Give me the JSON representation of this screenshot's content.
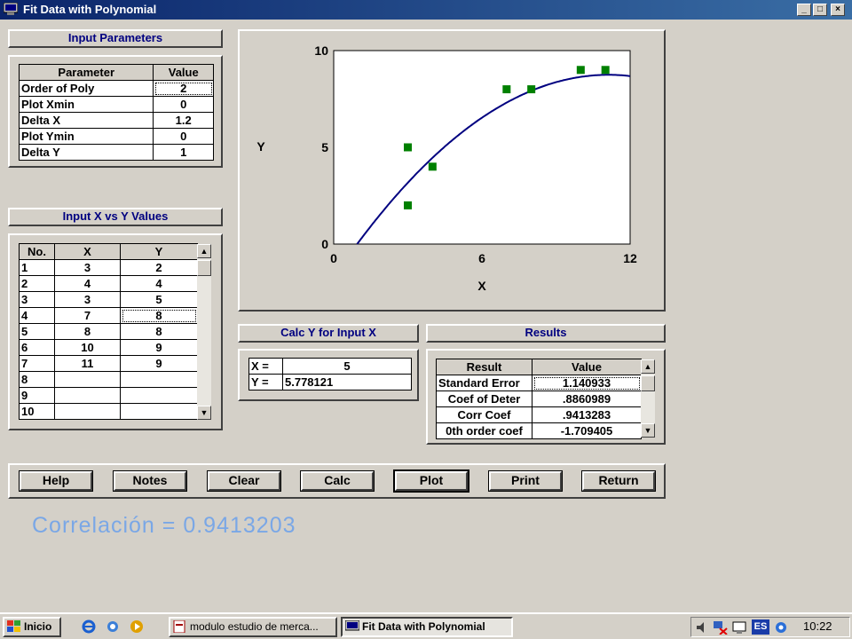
{
  "window": {
    "title": "Fit Data with Polynomial",
    "controls": [
      "_",
      "□",
      "×"
    ]
  },
  "input_parameters": {
    "header": "Input Parameters",
    "columns": [
      "Parameter",
      "Value"
    ],
    "rows": [
      [
        "Order of Poly",
        "2"
      ],
      [
        "Plot Xmin",
        "0"
      ],
      [
        "Delta X",
        "1.2"
      ],
      [
        "Plot Ymin",
        "0"
      ],
      [
        "Delta Y",
        "1"
      ]
    ]
  },
  "xy_values": {
    "header": "Input X vs Y Values",
    "columns": [
      "No.",
      "X",
      "Y"
    ],
    "rows": [
      [
        "1",
        "3",
        "2"
      ],
      [
        "2",
        "4",
        "4"
      ],
      [
        "3",
        "3",
        "5"
      ],
      [
        "4",
        "7",
        "8"
      ],
      [
        "5",
        "8",
        "8"
      ],
      [
        "6",
        "10",
        "9"
      ],
      [
        "7",
        "11",
        "9"
      ],
      [
        "8",
        "",
        ""
      ],
      [
        "9",
        "",
        ""
      ],
      [
        "10",
        "",
        ""
      ]
    ]
  },
  "chart_data": {
    "type": "scatter",
    "title": "",
    "xlabel": "X",
    "ylabel": "Y",
    "xlim": [
      0,
      12
    ],
    "ylim": [
      0,
      10
    ],
    "xticks": [
      "0",
      "6",
      "12"
    ],
    "yticks": [
      "0",
      "5",
      "10"
    ],
    "grid": false,
    "points": [
      {
        "x": 3,
        "y": 2
      },
      {
        "x": 4,
        "y": 4
      },
      {
        "x": 3,
        "y": 5
      },
      {
        "x": 7,
        "y": 8
      },
      {
        "x": 8,
        "y": 8
      },
      {
        "x": 10,
        "y": 9
      },
      {
        "x": 11,
        "y": 9
      }
    ],
    "fit_coefficients": [
      -1.709405,
      1.88,
      -0.0845
    ],
    "colors": {
      "points": "#008000",
      "curve": "#000080",
      "plot_bg": "#ffffff"
    }
  },
  "calc": {
    "header": "Calc Y for Input X",
    "x_label": "X =",
    "x_value": "5",
    "y_label": "Y =",
    "y_value": "5.778121"
  },
  "results": {
    "header": "Results",
    "columns": [
      "Result",
      "Value"
    ],
    "rows": [
      [
        "Standard Error",
        "1.140933"
      ],
      [
        "Coef of Deter",
        ".8860989"
      ],
      [
        "Corr Coef",
        ".9413283"
      ],
      [
        "0th order coef",
        "-1.709405"
      ]
    ]
  },
  "buttons": {
    "help": "Help",
    "notes": "Notes",
    "clear": "Clear",
    "calc": "Calc",
    "plot": "Plot",
    "print": "Print",
    "return": "Return"
  },
  "annotation": "Correlación = 0.9413203",
  "taskbar": {
    "start": "Inicio",
    "tasks": [
      "modulo estudio de merca...",
      "Fit Data with Polynomial"
    ],
    "lang": "ES",
    "clock": "10:22"
  }
}
